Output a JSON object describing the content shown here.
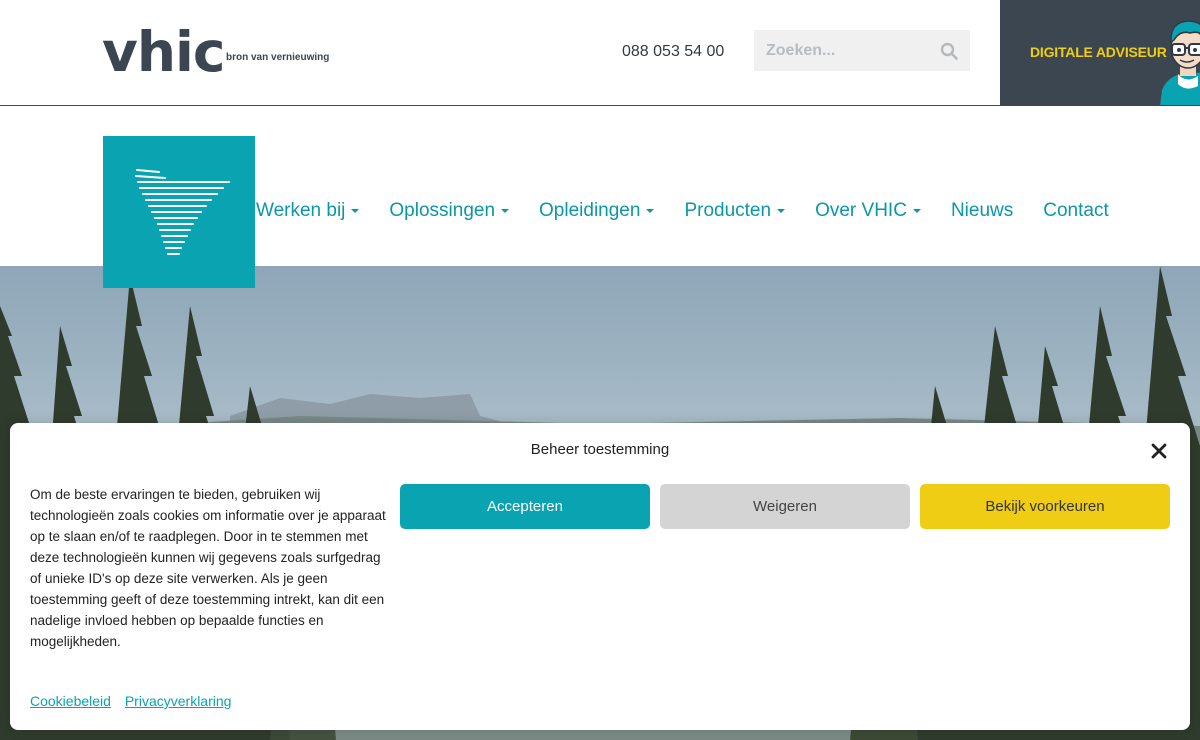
{
  "header": {
    "logo_text": "vhic",
    "logo_tagline": "bron van vernieuwing",
    "phone": "088 053 54 00",
    "search_placeholder": "Zoeken...",
    "adviseur_label": "DIGITALE ADVISEUR"
  },
  "nav": {
    "items": [
      {
        "label": "Werken bij",
        "dropdown": true
      },
      {
        "label": "Oplossingen",
        "dropdown": true
      },
      {
        "label": "Opleidingen",
        "dropdown": true
      },
      {
        "label": "Producten",
        "dropdown": true
      },
      {
        "label": "Over VHIC",
        "dropdown": true
      },
      {
        "label": "Nieuws",
        "dropdown": false
      },
      {
        "label": "Contact",
        "dropdown": false
      }
    ]
  },
  "consent": {
    "title": "Beheer toestemming",
    "body": "Om de beste ervaringen te bieden, gebruiken wij technologieën zoals cookies om informatie over je apparaat op te slaan en/of te raadplegen. Door in te stemmen met deze technologieën kunnen wij gegevens zoals surfgedrag of unieke ID's op deze site verwerken. Als je geen toestemming geeft of deze toestemming intrekt, kan dit een nadelige invloed hebben op bepaalde functies en mogelijkheden.",
    "accept_label": "Accepteren",
    "deny_label": "Weigeren",
    "prefs_label": "Bekijk voorkeuren",
    "cookie_link": "Cookiebeleid",
    "privacy_link": "Privacyverklaring"
  },
  "colors": {
    "brand_teal": "#0aa3b1",
    "brand_dark": "#3c4650",
    "brand_yellow": "#f0cd15",
    "deny_grey": "#d4d4d4"
  }
}
